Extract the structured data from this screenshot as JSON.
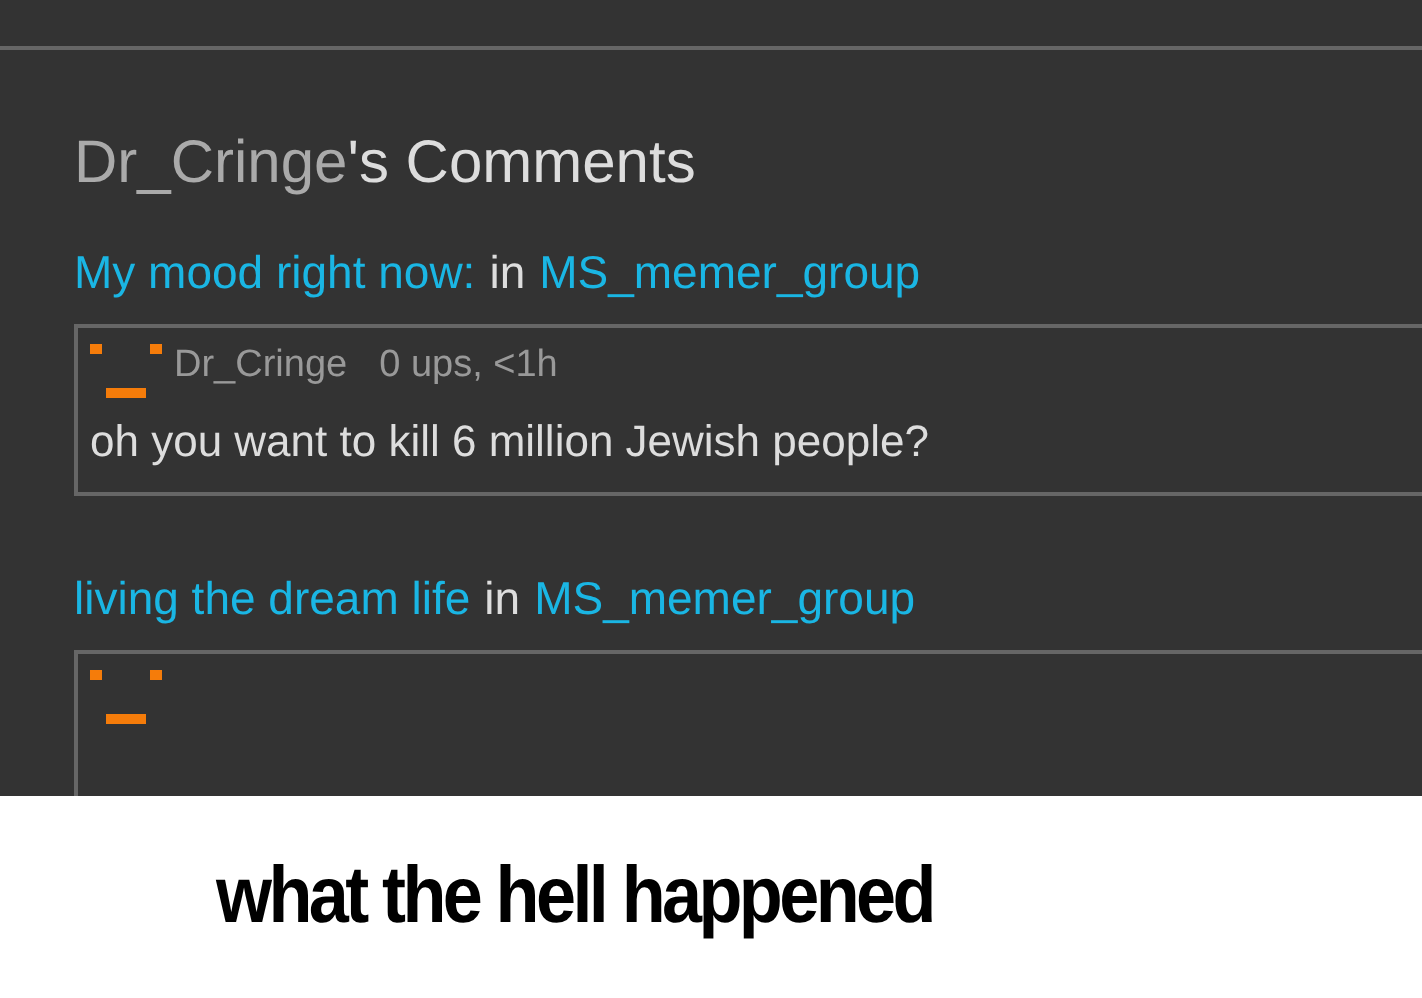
{
  "page_title": {
    "user": "Dr_Cringe",
    "suffix": "'s Comments"
  },
  "entries": [
    {
      "post": "My mood right now:",
      "joiner": "in",
      "group": "MS_memer_group",
      "comment": {
        "kind": "full",
        "author": "Dr_Cringe",
        "meta": "0 ups, <1h",
        "body": "oh you want to kill 6 million Jewish people?"
      }
    },
    {
      "post": "living the dream life",
      "joiner": "in",
      "group": "MS_memer_group",
      "comment": {
        "kind": "cut"
      }
    }
  ],
  "caption": "what the hell happened"
}
